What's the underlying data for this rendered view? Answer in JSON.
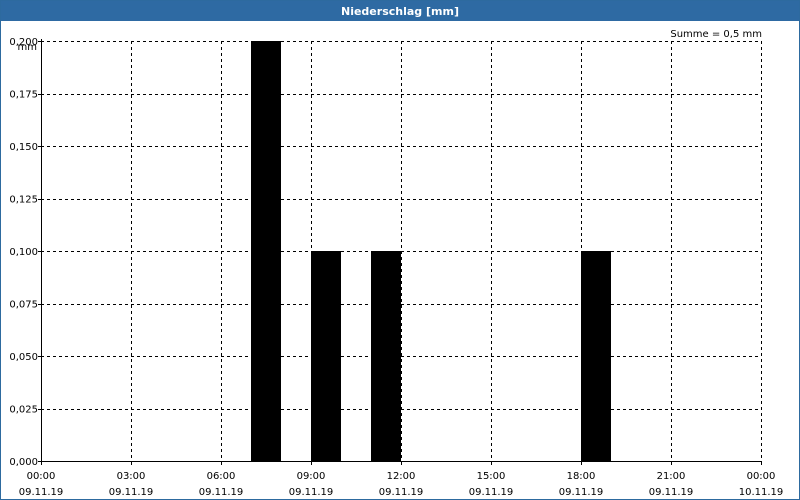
{
  "window": {
    "title": "Niederschlag [mm]"
  },
  "chart_data": {
    "type": "bar",
    "title": "Niederschlag [mm]",
    "ylabel": "mm",
    "annotation": "Summe = 0,5 mm",
    "ylim": [
      0,
      0.2
    ],
    "y_ticks": [
      "0,000",
      "0,025",
      "0,050",
      "0,075",
      "0,100",
      "0,125",
      "0,150",
      "0,175",
      "0,200"
    ],
    "x_range_hours": [
      0,
      24
    ],
    "x_ticks": [
      {
        "time": "00:00",
        "date": "09.11.19",
        "hour": 0
      },
      {
        "time": "03:00",
        "date": "09.11.19",
        "hour": 3
      },
      {
        "time": "06:00",
        "date": "09.11.19",
        "hour": 6
      },
      {
        "time": "09:00",
        "date": "09.11.19",
        "hour": 9
      },
      {
        "time": "12:00",
        "date": "09.11.19",
        "hour": 12
      },
      {
        "time": "15:00",
        "date": "09.11.19",
        "hour": 15
      },
      {
        "time": "18:00",
        "date": "09.11.19",
        "hour": 18
      },
      {
        "time": "21:00",
        "date": "09.11.19",
        "hour": 21
      },
      {
        "time": "00:00",
        "date": "10.11.19",
        "hour": 24
      }
    ],
    "bars": [
      {
        "hour_start": 7.0,
        "hour_end": 8.0,
        "value": 0.2
      },
      {
        "hour_start": 9.0,
        "hour_end": 10.0,
        "value": 0.1
      },
      {
        "hour_start": 11.0,
        "hour_end": 12.0,
        "value": 0.1
      },
      {
        "hour_start": 18.0,
        "hour_end": 19.0,
        "value": 0.1
      }
    ],
    "bar_color": "#000000",
    "grid": true
  }
}
